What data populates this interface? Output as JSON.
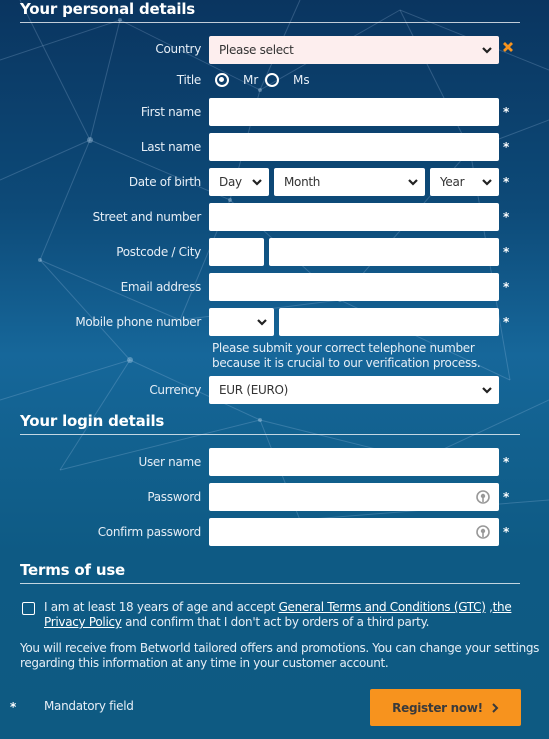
{
  "sections": {
    "personal": "Your personal details",
    "login": "Your login details",
    "terms": "Terms of use"
  },
  "fields": {
    "country": {
      "label": "Country",
      "value": "Please select",
      "error_icon": "x-icon"
    },
    "title": {
      "label": "Title",
      "options": [
        "Mr",
        "Ms"
      ],
      "selected": "Mr"
    },
    "first_name": {
      "label": "First name",
      "value": ""
    },
    "last_name": {
      "label": "Last name",
      "value": ""
    },
    "dob": {
      "label": "Date of birth",
      "day": "Day",
      "month": "Month",
      "year": "Year"
    },
    "street": {
      "label": "Street and number",
      "value": ""
    },
    "postcode_city": {
      "label": "Postcode / City",
      "postcode": "",
      "city": ""
    },
    "email": {
      "label": "Email address",
      "value": ""
    },
    "mobile": {
      "label": "Mobile phone number",
      "prefix": "",
      "value": "",
      "hint": "Please submit your correct telephone number because it is crucial to our verification process."
    },
    "currency": {
      "label": "Currency",
      "value": "EUR (EURO)"
    },
    "username": {
      "label": "User name",
      "value": ""
    },
    "password": {
      "label": "Password",
      "value": "",
      "icon": "eye-icon"
    },
    "confirm_password": {
      "label": "Confirm password",
      "value": "",
      "icon": "eye-icon"
    }
  },
  "required_marker": "*",
  "terms": {
    "prefix": "I am at least 18 years of age and accept ",
    "gtc_link": "General Terms and Conditions (GTC)",
    "separator": " ,",
    "privacy_link": "the Privacy Policy",
    "suffix": " and confirm that I don't act by orders of a third party.",
    "checked": false
  },
  "offers_text": "You will receive from Betworld tailored offers and promotions. You can change your settings regarding this information at any time in your customer account.",
  "footer": {
    "mandatory_label": "Mandatory field",
    "register_label": "Register now!"
  },
  "colors": {
    "accent": "#f7931e",
    "error": "#f7931e",
    "background": "#0e5a82"
  }
}
